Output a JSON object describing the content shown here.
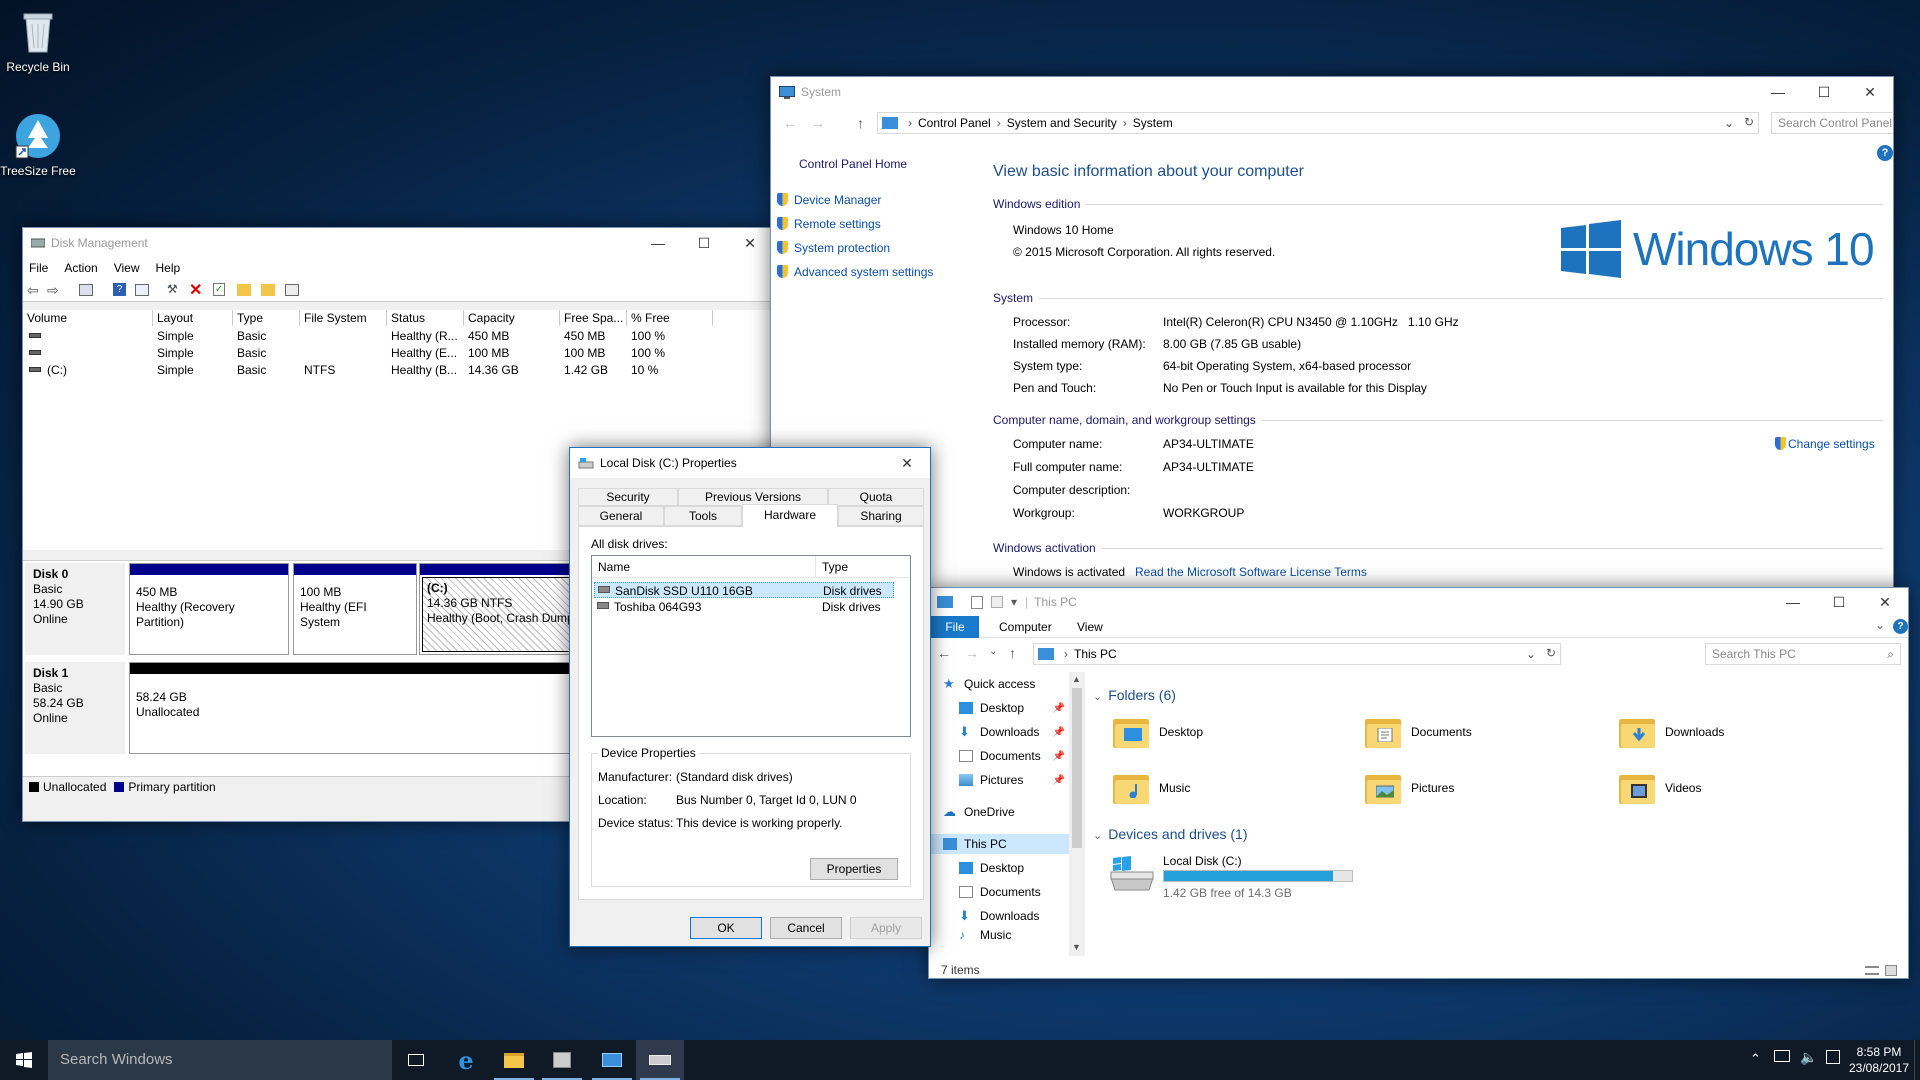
{
  "desktop": {
    "icons": [
      {
        "label": "Recycle Bin",
        "icon": "recycle-bin-icon"
      },
      {
        "label": "TreeSize Free",
        "icon": "treesize-icon"
      }
    ]
  },
  "disk_mgmt": {
    "title": "Disk Management",
    "menu": [
      "File",
      "Action",
      "View",
      "Help"
    ],
    "columns": [
      "Volume",
      "Layout",
      "Type",
      "File System",
      "Status",
      "Capacity",
      "Free Spa...",
      "% Free"
    ],
    "rows": [
      [
        "",
        "Simple",
        "Basic",
        "",
        "Healthy (R...",
        "450 MB",
        "450 MB",
        "100 %"
      ],
      [
        "",
        "Simple",
        "Basic",
        "",
        "Healthy (E...",
        "100 MB",
        "100 MB",
        "100 %"
      ],
      [
        "(C:)",
        "Simple",
        "Basic",
        "NTFS",
        "Healthy (B...",
        "14.36 GB",
        "1.42 GB",
        "10 %"
      ]
    ],
    "disks": [
      {
        "name": "Disk 0",
        "type": "Basic",
        "size": "14.90 GB",
        "state": "Online",
        "partitions": [
          {
            "title": "",
            "line1": "450 MB",
            "line2": "Healthy (Recovery Partition)"
          },
          {
            "title": "",
            "line1": "100 MB",
            "line2": "Healthy (EFI System"
          },
          {
            "title": "(C:)",
            "line1": "14.36 GB NTFS",
            "line2": "Healthy (Boot, Crash Dump"
          }
        ]
      },
      {
        "name": "Disk 1",
        "type": "Basic",
        "size": "58.24 GB",
        "state": "Online",
        "partitions": [
          {
            "title": "",
            "line1": "58.24 GB",
            "line2": "Unallocated"
          }
        ]
      }
    ],
    "legend": [
      "Unallocated",
      "Primary partition"
    ],
    "colors": {
      "primary": "#00008b",
      "unallocated": "#000000"
    }
  },
  "props": {
    "title": "Local Disk (C:) Properties",
    "tabs_row1": [
      "Security",
      "Previous Versions",
      "Quota"
    ],
    "tabs_row2": [
      "General",
      "Tools",
      "Hardware",
      "Sharing"
    ],
    "active_tab": "Hardware",
    "all_drives_label": "All disk drives:",
    "list_headers": [
      "Name",
      "Type"
    ],
    "drives": [
      {
        "name": "SanDisk SSD U110 16GB",
        "type": "Disk drives"
      },
      {
        "name": "Toshiba 064G93",
        "type": "Disk drives"
      }
    ],
    "device_props_label": "Device Properties",
    "manufacturer_label": "Manufacturer:",
    "manufacturer": "(Standard disk drives)",
    "location_label": "Location:",
    "location": "Bus Number 0, Target Id 0, LUN 0",
    "status_label": "Device status:",
    "status": "This device is working properly.",
    "properties_btn": "Properties",
    "ok": "OK",
    "cancel": "Cancel",
    "apply": "Apply"
  },
  "system": {
    "title": "System",
    "breadcrumb": [
      "Control Panel",
      "System and Security",
      "System"
    ],
    "search_placeholder": "Search Control Panel",
    "sidebar_home": "Control Panel Home",
    "sidebar_links": [
      "Device Manager",
      "Remote settings",
      "System protection",
      "Advanced system settings"
    ],
    "heading": "View basic information about your computer",
    "edition_header": "Windows edition",
    "edition": "Windows 10 Home",
    "copyright": "© 2015 Microsoft Corporation. All rights reserved.",
    "logo_text": "Windows 10",
    "system_header": "System",
    "system_rows": [
      {
        "label": "Processor:",
        "value": "Intel(R) Celeron(R) CPU N3450 @ 1.10GHz   1.10 GHz"
      },
      {
        "label": "Installed memory (RAM):",
        "value": "8.00 GB (7.85 GB usable)"
      },
      {
        "label": "System type:",
        "value": "64-bit Operating System, x64-based processor"
      },
      {
        "label": "Pen and Touch:",
        "value": "No Pen or Touch Input is available for this Display"
      }
    ],
    "computer_header": "Computer name, domain, and workgroup settings",
    "computer_rows": [
      {
        "label": "Computer name:",
        "value": "AP34-ULTIMATE"
      },
      {
        "label": "Full computer name:",
        "value": "AP34-ULTIMATE"
      },
      {
        "label": "Computer description:",
        "value": ""
      },
      {
        "label": "Workgroup:",
        "value": "WORKGROUP"
      }
    ],
    "change_settings": "Change settings",
    "activation_header": "Windows activation",
    "activation_text": "Windows is activated",
    "license_link": "Read the Microsoft Software License Terms",
    "colors": {
      "accent": "#1e73be",
      "logo": "#1e73be"
    }
  },
  "thispc": {
    "title": "This PC",
    "ribbon_tabs": [
      "File",
      "Computer",
      "View"
    ],
    "address": "This PC",
    "search_placeholder": "Search This PC",
    "nav": {
      "quick_access": "Quick access",
      "quick_items": [
        "Desktop",
        "Downloads",
        "Documents",
        "Pictures"
      ],
      "onedrive": "OneDrive",
      "this_pc": "This PC",
      "pc_items": [
        "Desktop",
        "Documents",
        "Downloads",
        "Music"
      ]
    },
    "folders_header": "Folders (6)",
    "folders": [
      "Desktop",
      "Documents",
      "Downloads",
      "Music",
      "Pictures",
      "Videos"
    ],
    "devices_header": "Devices and drives (1)",
    "drive": {
      "name": "Local Disk (C:)",
      "free_text": "1.42 GB free of 14.3 GB",
      "used_fraction": 0.9
    },
    "status": "7 items"
  },
  "taskbar": {
    "search_placeholder": "Search Windows",
    "time": "8:58 PM",
    "date": "23/08/2017"
  }
}
